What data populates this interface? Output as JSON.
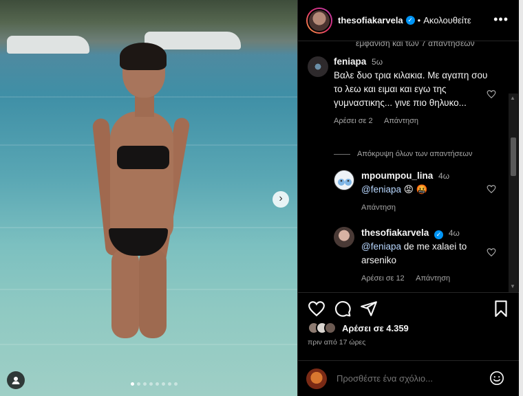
{
  "post": {
    "username": "thesofiakarvela",
    "separator": "•",
    "follow_label": "Ακολουθείτε",
    "more_icon": "more-horizontal-icon",
    "verified_icon": "verified-badge-icon"
  },
  "comments_top_cut": "εμφάνιση και των 7 απαντήσεων",
  "comments": [
    {
      "username": "feniapa",
      "time": "5ω",
      "text": "Βαλε δυο τρια κιλακια. Με αγαπη σου το λεω και ειμαι και εγω της γυμναστικης... γινε πιο θηλυκο...",
      "likes": "Αρέσει σε 2",
      "reply": "Απάντηση"
    }
  ],
  "hide_replies_label": "Απόκρυψη όλων των απαντήσεων",
  "replies": [
    {
      "username": "mpoumpou_lina",
      "time": "4ω",
      "mention": "@feniapa",
      "text": " 😡 🤬",
      "reply": "Απάντηση"
    },
    {
      "username": "thesofiakarvela",
      "time": "4ω",
      "mention": "@feniapa",
      "text": " de me xalaei to arseniko",
      "likes": "Αρέσει σε 12",
      "reply": "Απάντηση"
    }
  ],
  "actions": {
    "like_icon": "heart-icon",
    "comment_icon": "comment-icon",
    "share_icon": "share-icon",
    "save_icon": "bookmark-icon"
  },
  "likes_text": "Αρέσει σε 4.359",
  "posted_ago": "πριν από 17 ώρες",
  "add_comment_placeholder": "Προσθέστε ένα σχόλιο...",
  "colors": {
    "background": "#000000",
    "text": "#f5f5f5",
    "muted": "#a8a8a8",
    "verified": "#0095f6",
    "mention": "#b8d7ff"
  }
}
